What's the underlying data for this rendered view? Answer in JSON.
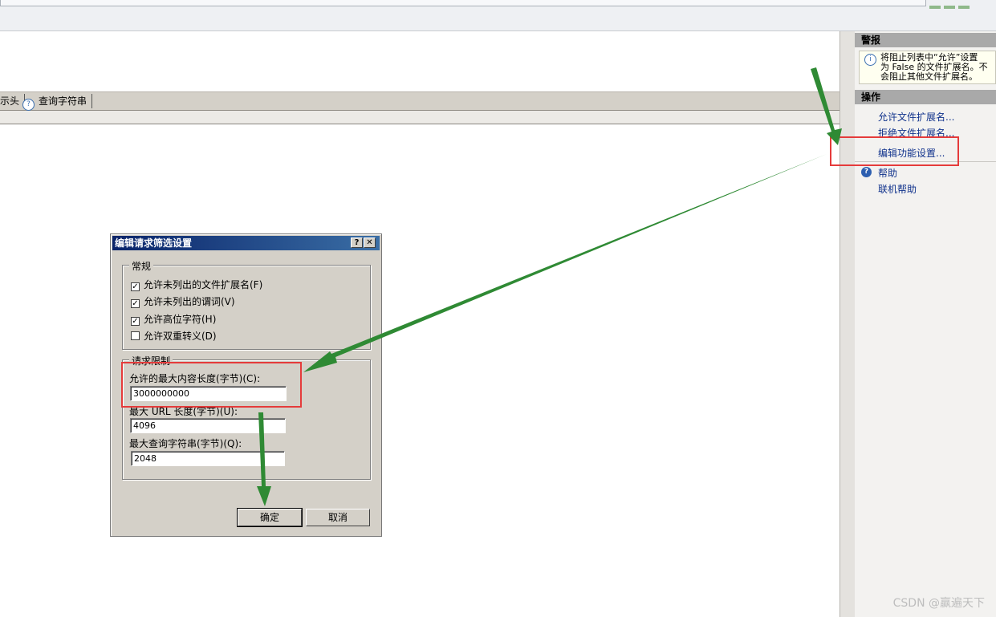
{
  "tabs": {
    "partial_label": "示头",
    "query_label": "查询字符串"
  },
  "alerts": {
    "header": "警报",
    "lines": [
      "将阻止列表中“允许”设置",
      "为 False 的文件扩展名。不",
      "会阻止其他文件扩展名。"
    ]
  },
  "actions": {
    "header": "操作",
    "items": [
      {
        "label": "允许文件扩展名..."
      },
      {
        "label": "拒绝文件扩展名..."
      },
      {
        "label": "编辑功能设置..."
      }
    ],
    "help": "帮助",
    "online_help": "联机帮助"
  },
  "dialog": {
    "title": "编辑请求筛选设置",
    "help_btn": "?",
    "close_btn": "✕",
    "general_group": "常规",
    "checkboxes": [
      {
        "label": "允许未列出的文件扩展名(F)",
        "checked": true
      },
      {
        "label": "允许未列出的谓词(V)",
        "checked": true
      },
      {
        "label": "允许高位字符(H)",
        "checked": true
      },
      {
        "label": "允许双重转义(D)",
        "checked": false
      }
    ],
    "limits_group": "请求限制",
    "max_content_label": "允许的最大内容长度(字节)(C):",
    "max_content_value": "3000000000",
    "max_url_label": "最大 URL 长度(字节)(U):",
    "max_url_value": "4096",
    "max_query_label": "最大查询字符串(字节)(Q):",
    "max_query_value": "2048",
    "ok": "确定",
    "cancel": "取消"
  },
  "watermark": "CSDN @赢遍天下",
  "colors": {
    "annotation_red": "#e53b3b",
    "annotation_arrow": "#2f8a34",
    "title_bar": "#0a246a",
    "link": "#10328c"
  }
}
